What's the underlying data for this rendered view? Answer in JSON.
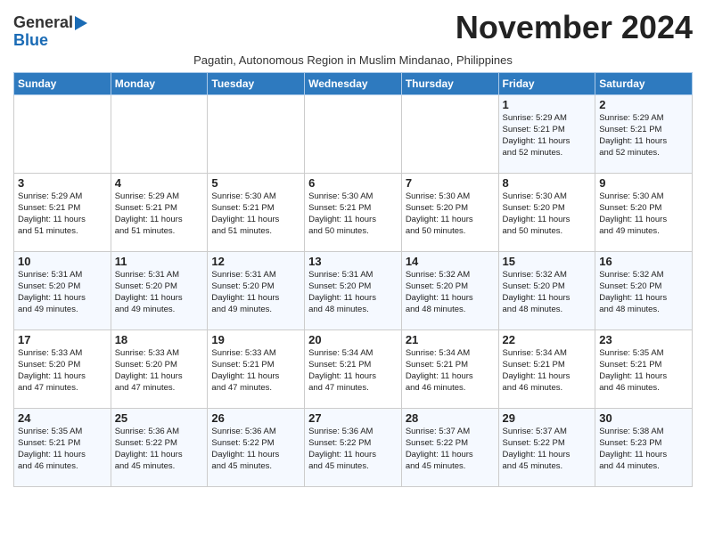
{
  "logo": {
    "line1": "General",
    "line2": "Blue"
  },
  "title": "November 2024",
  "subtitle": "Pagatin, Autonomous Region in Muslim Mindanao, Philippines",
  "headers": [
    "Sunday",
    "Monday",
    "Tuesday",
    "Wednesday",
    "Thursday",
    "Friday",
    "Saturday"
  ],
  "weeks": [
    [
      {
        "day": "",
        "info": ""
      },
      {
        "day": "",
        "info": ""
      },
      {
        "day": "",
        "info": ""
      },
      {
        "day": "",
        "info": ""
      },
      {
        "day": "",
        "info": ""
      },
      {
        "day": "1",
        "info": "Sunrise: 5:29 AM\nSunset: 5:21 PM\nDaylight: 11 hours\nand 52 minutes."
      },
      {
        "day": "2",
        "info": "Sunrise: 5:29 AM\nSunset: 5:21 PM\nDaylight: 11 hours\nand 52 minutes."
      }
    ],
    [
      {
        "day": "3",
        "info": "Sunrise: 5:29 AM\nSunset: 5:21 PM\nDaylight: 11 hours\nand 51 minutes."
      },
      {
        "day": "4",
        "info": "Sunrise: 5:29 AM\nSunset: 5:21 PM\nDaylight: 11 hours\nand 51 minutes."
      },
      {
        "day": "5",
        "info": "Sunrise: 5:30 AM\nSunset: 5:21 PM\nDaylight: 11 hours\nand 51 minutes."
      },
      {
        "day": "6",
        "info": "Sunrise: 5:30 AM\nSunset: 5:21 PM\nDaylight: 11 hours\nand 50 minutes."
      },
      {
        "day": "7",
        "info": "Sunrise: 5:30 AM\nSunset: 5:20 PM\nDaylight: 11 hours\nand 50 minutes."
      },
      {
        "day": "8",
        "info": "Sunrise: 5:30 AM\nSunset: 5:20 PM\nDaylight: 11 hours\nand 50 minutes."
      },
      {
        "day": "9",
        "info": "Sunrise: 5:30 AM\nSunset: 5:20 PM\nDaylight: 11 hours\nand 49 minutes."
      }
    ],
    [
      {
        "day": "10",
        "info": "Sunrise: 5:31 AM\nSunset: 5:20 PM\nDaylight: 11 hours\nand 49 minutes."
      },
      {
        "day": "11",
        "info": "Sunrise: 5:31 AM\nSunset: 5:20 PM\nDaylight: 11 hours\nand 49 minutes."
      },
      {
        "day": "12",
        "info": "Sunrise: 5:31 AM\nSunset: 5:20 PM\nDaylight: 11 hours\nand 49 minutes."
      },
      {
        "day": "13",
        "info": "Sunrise: 5:31 AM\nSunset: 5:20 PM\nDaylight: 11 hours\nand 48 minutes."
      },
      {
        "day": "14",
        "info": "Sunrise: 5:32 AM\nSunset: 5:20 PM\nDaylight: 11 hours\nand 48 minutes."
      },
      {
        "day": "15",
        "info": "Sunrise: 5:32 AM\nSunset: 5:20 PM\nDaylight: 11 hours\nand 48 minutes."
      },
      {
        "day": "16",
        "info": "Sunrise: 5:32 AM\nSunset: 5:20 PM\nDaylight: 11 hours\nand 48 minutes."
      }
    ],
    [
      {
        "day": "17",
        "info": "Sunrise: 5:33 AM\nSunset: 5:20 PM\nDaylight: 11 hours\nand 47 minutes."
      },
      {
        "day": "18",
        "info": "Sunrise: 5:33 AM\nSunset: 5:20 PM\nDaylight: 11 hours\nand 47 minutes."
      },
      {
        "day": "19",
        "info": "Sunrise: 5:33 AM\nSunset: 5:21 PM\nDaylight: 11 hours\nand 47 minutes."
      },
      {
        "day": "20",
        "info": "Sunrise: 5:34 AM\nSunset: 5:21 PM\nDaylight: 11 hours\nand 47 minutes."
      },
      {
        "day": "21",
        "info": "Sunrise: 5:34 AM\nSunset: 5:21 PM\nDaylight: 11 hours\nand 46 minutes."
      },
      {
        "day": "22",
        "info": "Sunrise: 5:34 AM\nSunset: 5:21 PM\nDaylight: 11 hours\nand 46 minutes."
      },
      {
        "day": "23",
        "info": "Sunrise: 5:35 AM\nSunset: 5:21 PM\nDaylight: 11 hours\nand 46 minutes."
      }
    ],
    [
      {
        "day": "24",
        "info": "Sunrise: 5:35 AM\nSunset: 5:21 PM\nDaylight: 11 hours\nand 46 minutes."
      },
      {
        "day": "25",
        "info": "Sunrise: 5:36 AM\nSunset: 5:22 PM\nDaylight: 11 hours\nand 45 minutes."
      },
      {
        "day": "26",
        "info": "Sunrise: 5:36 AM\nSunset: 5:22 PM\nDaylight: 11 hours\nand 45 minutes."
      },
      {
        "day": "27",
        "info": "Sunrise: 5:36 AM\nSunset: 5:22 PM\nDaylight: 11 hours\nand 45 minutes."
      },
      {
        "day": "28",
        "info": "Sunrise: 5:37 AM\nSunset: 5:22 PM\nDaylight: 11 hours\nand 45 minutes."
      },
      {
        "day": "29",
        "info": "Sunrise: 5:37 AM\nSunset: 5:22 PM\nDaylight: 11 hours\nand 45 minutes."
      },
      {
        "day": "30",
        "info": "Sunrise: 5:38 AM\nSunset: 5:23 PM\nDaylight: 11 hours\nand 44 minutes."
      }
    ]
  ]
}
